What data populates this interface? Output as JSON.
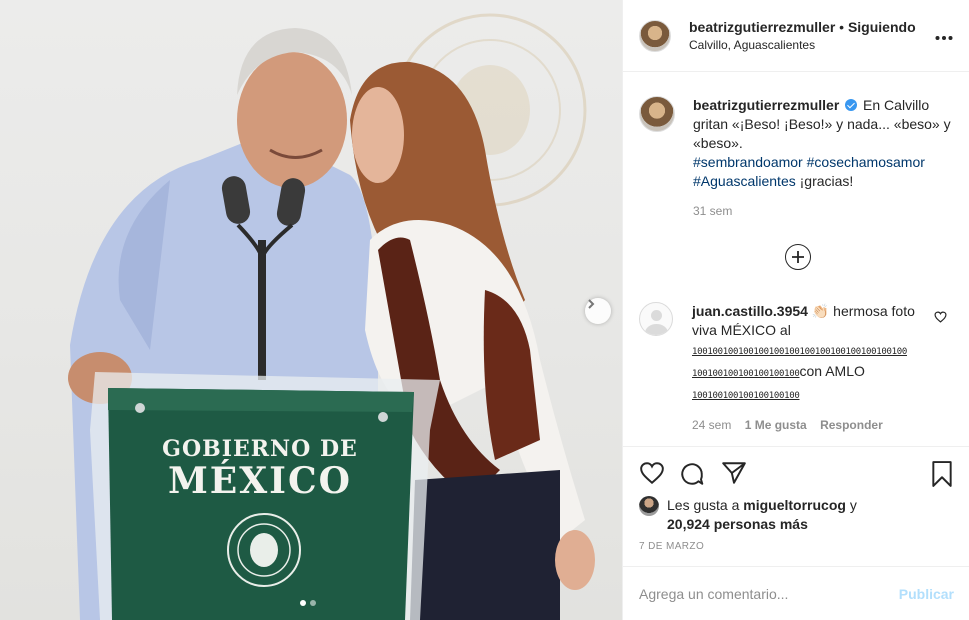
{
  "photo": {
    "podium_line1": "GOBIERNO DE",
    "podium_line2": "MÉXICO",
    "next_icon": "chevron-right-icon",
    "carousel_count": 2,
    "carousel_active": 1
  },
  "header": {
    "username": "beatrizgutierrezmuller",
    "separator": " • ",
    "follow_state": "Siguiendo",
    "location": "Calvillo, Aguascalientes",
    "more_icon": "ellipsis-icon"
  },
  "caption": {
    "username": "beatrizgutierrezmuller",
    "text": "En Calvillo gritan «¡Beso! ¡Beso!» y nada... «beso» y «beso».",
    "tags": [
      "#sembrandoamor",
      "#cosechamosamor",
      "#Aguascalientes"
    ],
    "tail": "¡gracias!",
    "age": "31 sem"
  },
  "comment": {
    "username": "juan.castillo.3954",
    "emoji": "👏🏻",
    "text_a": "hermosa foto viva MÉXICO al",
    "blocks_a": "100100100100100100100100100100100100100100",
    "blocks_b": "100100100100100100100",
    "text_b": "con AMLO",
    "blocks_c": "100100100100100100100",
    "age": "24 sem",
    "likes": "1 Me gusta",
    "reply": "Responder"
  },
  "likes": {
    "prefix": "Les gusta a",
    "user": "migueltorrucog",
    "conj": "y",
    "count": "20,924 personas más"
  },
  "date": "7 DE MARZO",
  "comment_box": {
    "placeholder": "Agrega un comentario...",
    "publish": "Publicar"
  },
  "colors": {
    "podium_green": "#1e5a44",
    "link_blue": "#00376b",
    "verified_blue": "#3897f0",
    "publish_disabled": "#b2dffc",
    "muted": "#8e8e8e"
  }
}
